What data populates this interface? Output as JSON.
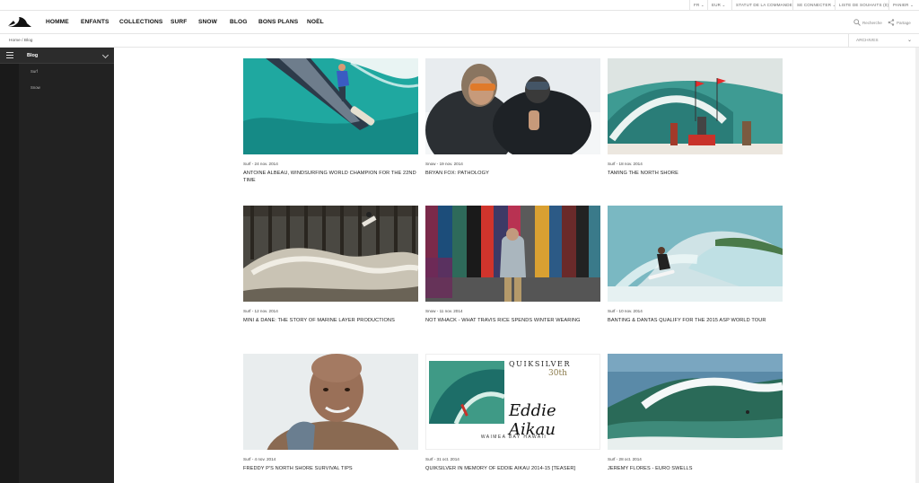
{
  "topbar": {
    "language": "FR",
    "currency": "EUR",
    "order_status": "STATUT DE LA COMMANDE",
    "login": "SE CONNECTER",
    "wishlist": "LISTE DE SOUHAITS (0)",
    "cart": "PANIER"
  },
  "nav": {
    "items": [
      "HOMME",
      "ENFANTS",
      "COLLECTIONS",
      "SURF",
      "SNOW",
      "BLOG",
      "BONS PLANS",
      "NOËL"
    ],
    "search_label": "Recherche",
    "share_label": "Partage"
  },
  "breadcrumb": {
    "home": "Home",
    "separator": "/",
    "current": "Blog"
  },
  "archives": {
    "label": "ARCHIVES"
  },
  "sidebar": {
    "title": "Blog",
    "items": [
      "Surf",
      "Snow"
    ]
  },
  "posts": [
    {
      "category": "Surf",
      "date": "24 nov. 2014",
      "title": "ANTOINE ALBEAU, WINDSURFING WORLD CHAMPION FOR THE 22ND TIME"
    },
    {
      "category": "Snow",
      "date": "19 nov. 2014",
      "title": "BRYAN FOX: PATHOLOGY"
    },
    {
      "category": "Surf",
      "date": "18 nov. 2014",
      "title": "TAMING THE NORTH SHORE"
    },
    {
      "category": "Surf",
      "date": "12 nov. 2014",
      "title": "MINI & DANE: THE STORY OF MARINE LAYER PRODUCTIONS"
    },
    {
      "category": "Snow",
      "date": "11 nov. 2014",
      "title": "NOT WHACK - WHAT TRAVIS RICE SPENDS WINTER WEARING"
    },
    {
      "category": "Surf",
      "date": "10 nov. 2014",
      "title": "BANTING & DANTAS QUALIFY FOR THE 2015 ASP WORLD TOUR"
    },
    {
      "category": "Surf",
      "date": "4 nov. 2014",
      "title": "FREDDY P'S NORTH SHORE SURVIVAL TIPS"
    },
    {
      "category": "Surf",
      "date": "31 oct. 2014",
      "title": "QUIKSILVER IN MEMORY OF EDDIE AIKAU 2014-15 [TEASER]"
    },
    {
      "category": "Surf",
      "date": "28 oct. 2014",
      "title": "JEREMY FLORES - EURO SWELLS"
    }
  ],
  "promo": {
    "brand": "QUIKSILVER",
    "anniversary": "30th",
    "event": "Eddie Aikau",
    "location": "WAIMEA BAY HAWAII"
  },
  "meta_separator": " - "
}
